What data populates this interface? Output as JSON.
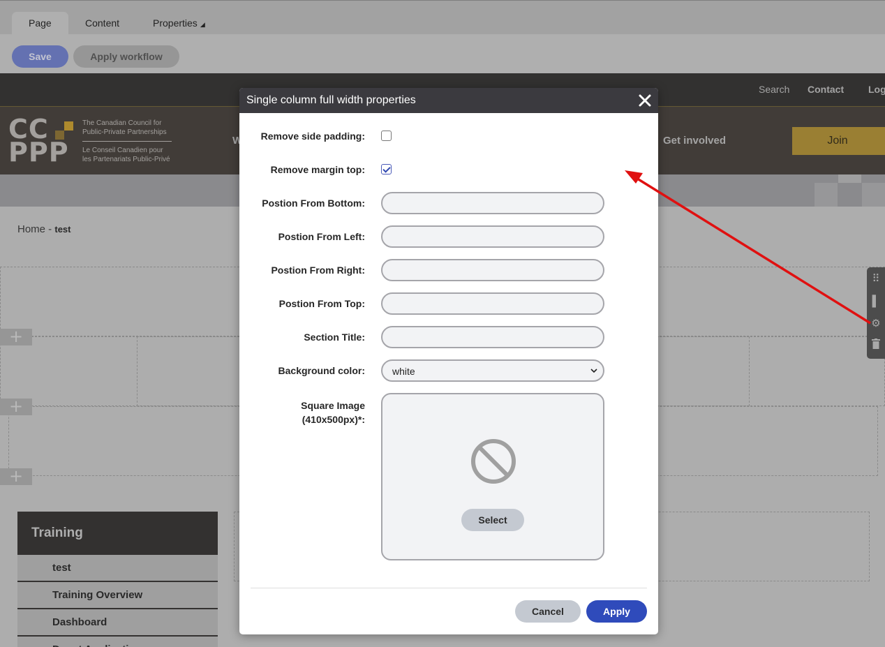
{
  "cms_tabs": [
    {
      "label": "Page"
    },
    {
      "label": "Content"
    },
    {
      "label": "Properties"
    }
  ],
  "toolbar": {
    "save_label": "Save",
    "workflow_label": "Apply workflow"
  },
  "top_nav": {
    "search": "Search",
    "contact": "Contact",
    "login": "Log"
  },
  "logo": {
    "letters_line1": "CC",
    "letters_line2": "PPP",
    "en_text": "The Canadian Council for Public-Private Partnerships",
    "fr_text": "Le Conseil Canadien pour les Partenariats Public-Privé",
    "accent": "#d5a937"
  },
  "main_nav": {
    "partial_item": "W",
    "get_involved": "Get involved",
    "join": "Join"
  },
  "breadcrumb": {
    "home": "Home",
    "separator": " - ",
    "current": "test"
  },
  "sidebar": {
    "heading": "Training",
    "items": [
      {
        "label": "test"
      },
      {
        "label": "Training Overview"
      },
      {
        "label": "Dashboard"
      },
      {
        "label": "Depot Application"
      }
    ]
  },
  "modal": {
    "title": "Single column full width properties",
    "fields": {
      "remove_side_padding": {
        "label": "Remove side padding:",
        "checked": false
      },
      "remove_margin_top": {
        "label": "Remove margin top:",
        "checked": true
      },
      "position_bottom": {
        "label": "Postion From Bottom:",
        "value": ""
      },
      "position_left": {
        "label": "Postion From Left:",
        "value": ""
      },
      "position_right": {
        "label": "Postion From Right:",
        "value": ""
      },
      "position_top": {
        "label": "Postion From Top:",
        "value": ""
      },
      "section_title": {
        "label": "Section Title:",
        "value": ""
      },
      "background_color": {
        "label": "Background color:",
        "value": "white"
      },
      "square_image": {
        "label_line1": "Square Image",
        "label_line2": "(410x500px)*:",
        "select_label": "Select",
        "icon": "no-image-icon"
      }
    },
    "cancel_label": "Cancel",
    "apply_label": "Apply"
  },
  "colors": {
    "primary_button": "#2f4bbb",
    "annotation_arrow": "#e01010",
    "header_dark": "#3b3a3f",
    "join_button": "#bc9c3f"
  }
}
